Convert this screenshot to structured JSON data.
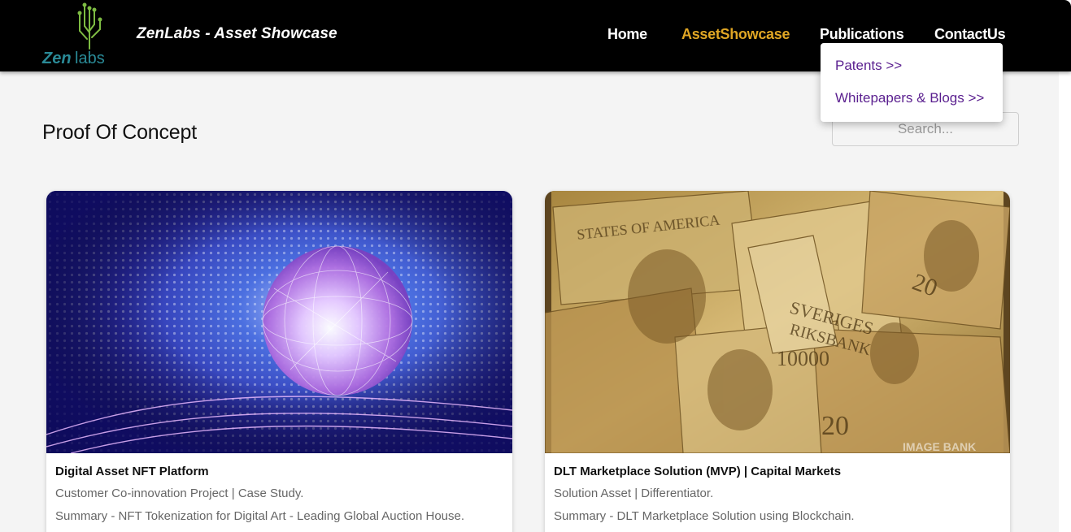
{
  "header": {
    "brand_title": "ZenLabs - Asset Showcase",
    "logo": {
      "word_bold": "Zen",
      "word_light": "labs",
      "teal": "#2a8a97",
      "green": "#7dbb42"
    },
    "nav": [
      {
        "label": "Home",
        "active": false
      },
      {
        "label": "AssetShowcase",
        "active": true
      },
      {
        "label": "Publications",
        "active": false
      },
      {
        "label": "ContactUs",
        "active": false
      }
    ],
    "active_color": "#e0a624"
  },
  "publications_menu": {
    "items": [
      {
        "label": "Patents >>"
      },
      {
        "label": "Whitepapers & Blogs >>"
      }
    ],
    "item_color": "#5a1f8f"
  },
  "page": {
    "title": "Proof Of Concept",
    "search_placeholder": "Search..."
  },
  "cards": [
    {
      "title": "Digital Asset NFT Platform",
      "type": "Customer Co-innovation Project | Case Study.",
      "summary": "Summary - NFT Tokenization for Digital Art - Leading Global Auction House.",
      "image": "glowing-network-sphere"
    },
    {
      "title": "DLT Marketplace Solution (MVP) | Capital Markets",
      "type": "Solution Asset | Differentiator.",
      "summary": "Summary - DLT Marketplace Solution using Blockchain.",
      "image": "world-banknotes-collage",
      "image_watermark": "IMAGE BANK"
    }
  ]
}
